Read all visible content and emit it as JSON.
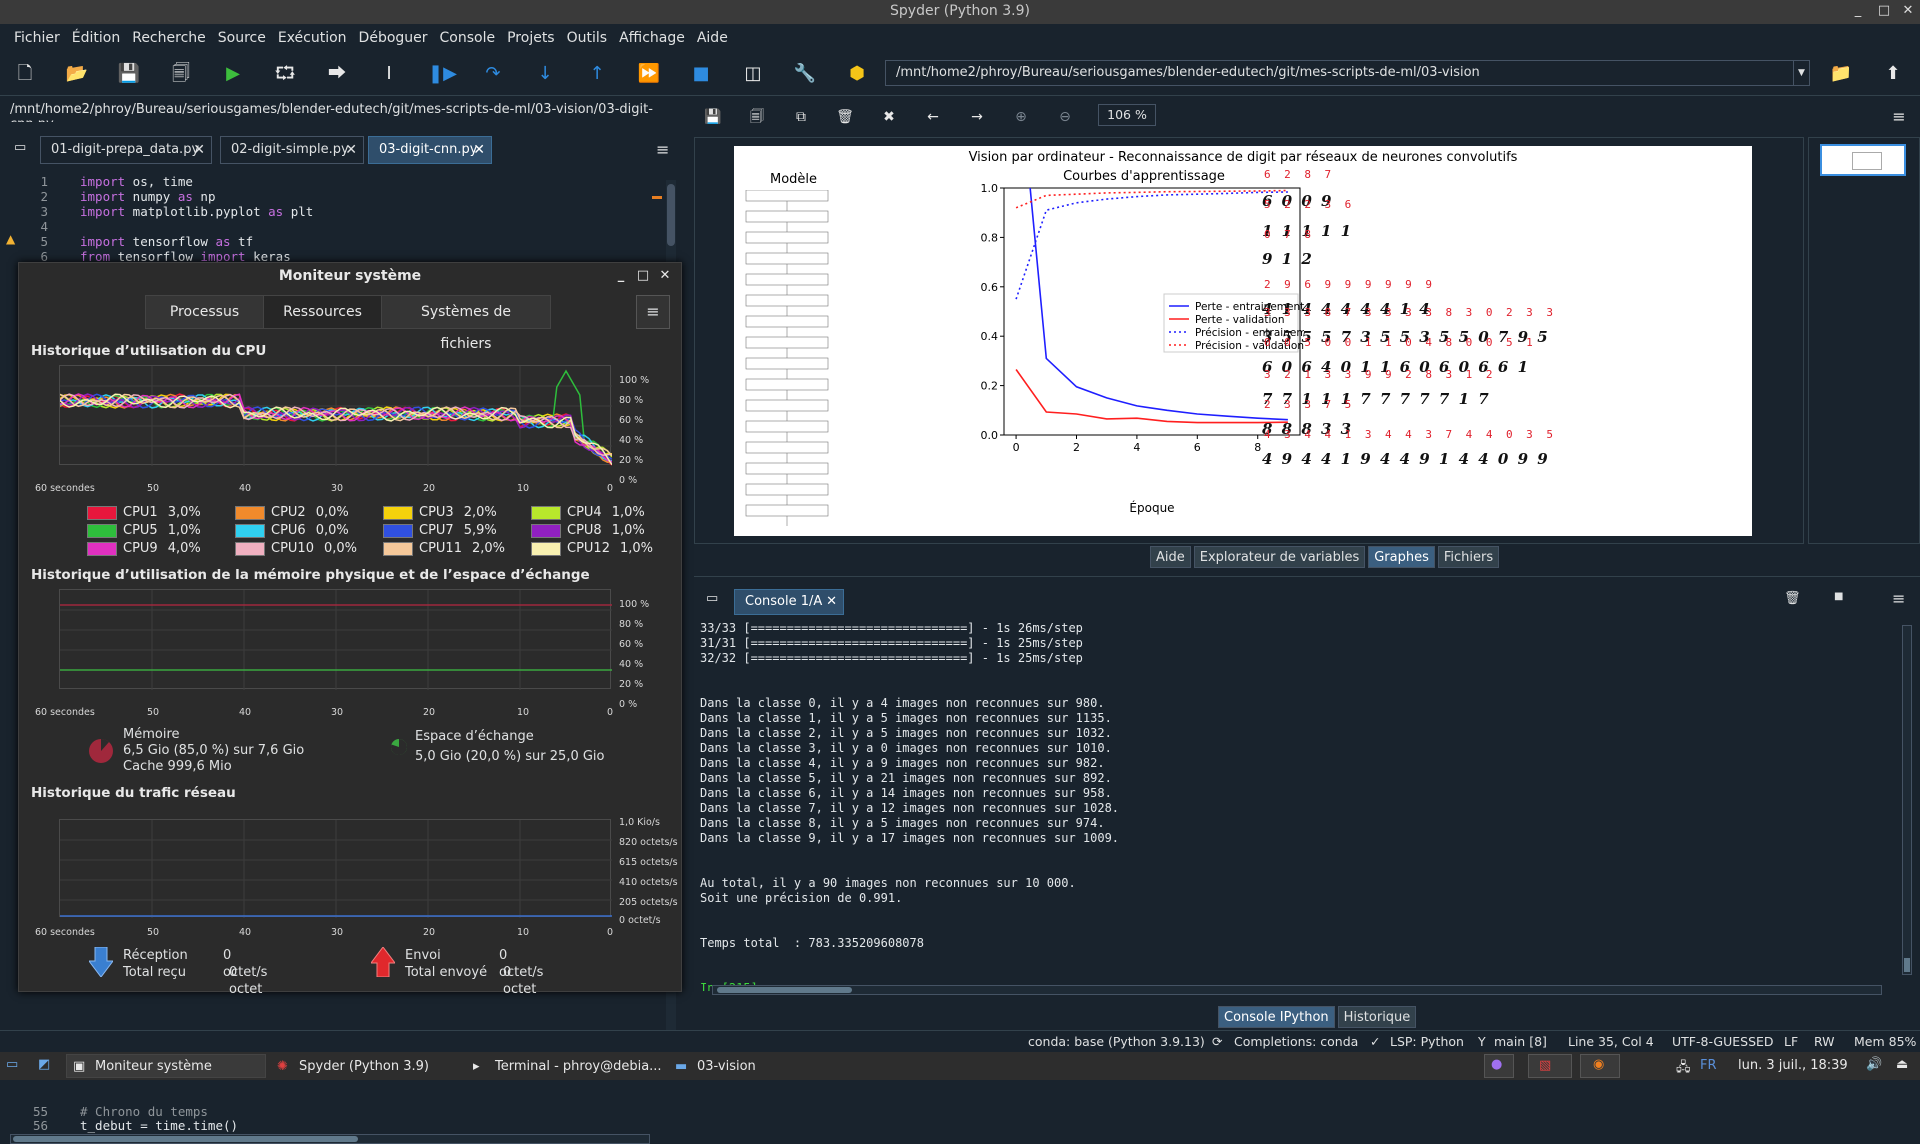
{
  "window": {
    "title": "Spyder (Python 3.9)"
  },
  "menu": [
    "Fichier",
    "Édition",
    "Recherche",
    "Source",
    "Exécution",
    "Déboguer",
    "Console",
    "Projets",
    "Outils",
    "Affichage",
    "Aide"
  ],
  "toolbar": {
    "working_dir": "/mnt/home2/phroy/Bureau/seriousgames/blender-edutech/git/mes-scripts-de-ml/03-vision"
  },
  "editor": {
    "path": "/mnt/home2/phroy/Bureau/seriousgames/blender-edutech/git/mes-scripts-de-ml/03-vision/03-digit-cnn.py",
    "tabs": [
      "01-digit-prepa_data.py",
      "02-digit-simple.py",
      "03-digit-cnn.py"
    ],
    "lines": [
      {
        "n": "1",
        "code": "import os, time"
      },
      {
        "n": "2",
        "code": "import numpy as np"
      },
      {
        "n": "3",
        "code": "import matplotlib.pyplot as plt"
      },
      {
        "n": "4",
        "code": ""
      },
      {
        "n": "5",
        "code": "import tensorflow as tf"
      },
      {
        "n": "6",
        "code": "from tensorflow import keras"
      }
    ],
    "bottom_lines": [
      {
        "n": "55",
        "code": "# Chrono du temps"
      },
      {
        "n": "56",
        "code": "t_debut = time.time()"
      }
    ]
  },
  "sysmon": {
    "title": "Moniteur système",
    "tabs": [
      "Processus",
      "Ressources",
      "Systèmes de fichiers"
    ],
    "cpu_heading": "Historique d’utilisation du CPU",
    "mem_heading": "Historique d’utilisation de la mémoire physique et de l’espace d’échange",
    "net_heading": "Historique du trafic réseau",
    "pct_ticks": [
      "100 %",
      "80 %",
      "60 %",
      "40 %",
      "20 %",
      "0 %"
    ],
    "time_ticks": [
      "60 secondes",
      "50",
      "40",
      "30",
      "20",
      "10",
      "0"
    ],
    "net_ticks": [
      "1,0 Kio/s",
      "820 octets/s",
      "615 octets/s",
      "410 octets/s",
      "205 octets/s",
      "0 octet/s"
    ],
    "cpus": [
      {
        "name": "CPU1",
        "value": "3,0%",
        "color": "#e8173c"
      },
      {
        "name": "CPU2",
        "value": "0,0%",
        "color": "#f08a2c"
      },
      {
        "name": "CPU3",
        "value": "2,0%",
        "color": "#f5d20c"
      },
      {
        "name": "CPU4",
        "value": "1,0%",
        "color": "#b8e82c"
      },
      {
        "name": "CPU5",
        "value": "1,0%",
        "color": "#2ebd3c"
      },
      {
        "name": "CPU6",
        "value": "0,0%",
        "color": "#30d0f0"
      },
      {
        "name": "CPU7",
        "value": "5,9%",
        "color": "#3050e0"
      },
      {
        "name": "CPU8",
        "value": "1,0%",
        "color": "#9020c0"
      },
      {
        "name": "CPU9",
        "value": "4,0%",
        "color": "#e030c0"
      },
      {
        "name": "CPU10",
        "value": "0,0%",
        "color": "#f0b0c0"
      },
      {
        "name": "CPU11",
        "value": "2,0%",
        "color": "#f5c89a"
      },
      {
        "name": "CPU12",
        "value": "1,0%",
        "color": "#f8f0b0"
      }
    ],
    "memory": {
      "label": "Mémoire",
      "line1": "6,5  Gio (85,0  %) sur 7,6  Gio",
      "line2": "Cache 999,6  Mio"
    },
    "swap": {
      "label": "Espace d’échange",
      "line1": "5,0  Gio (20,0  %) sur 25,0  Gio"
    },
    "net": {
      "recv_label": "Réception",
      "recv_value": "0 octet/s",
      "recv_total_label": "Total reçu",
      "recv_total": "0 octet",
      "send_label": "Envoi",
      "send_value": "0 octet/s",
      "send_total_label": "Total envoyé",
      "send_total": "0 octet"
    }
  },
  "plot": {
    "zoom": "106 %",
    "suptitle": "Vision par ordinateur - Reconnaissance de digit par réseaux de neurones convolutifs",
    "model_title": "Modèle",
    "legend": [
      "Perte - entrainement",
      "Perte - validation",
      "Précision - entrainement",
      "Précision - validation"
    ],
    "digit_rows": [
      {
        "labels": "6  2  8  7",
        "digits": "6 0 0 9"
      },
      {
        "labels": "5  2  2  3  6",
        "digits": "1 1 1 1 1"
      },
      {
        "labels": "0  7  8",
        "digits": "9 1 2"
      },
      {
        "labels": "2  9  6  9  9  9  9  9  9",
        "digits": "4 1 4 4 4 4 4 1 4"
      },
      {
        "labels": "3  3  3  8  7  3  3  3  3  8  3  0  2  3  3",
        "digits": "3 5 5 5 7 3 5 5 3 5 5 0 7 9 5"
      },
      {
        "labels": "0  0  5  0  0  1  1  0  4  8  0  0  5  1",
        "digits": "6 0 6 4 0 1 1 6 0 6 0 6 6 1"
      },
      {
        "labels": "3  2  1  3  3  9  9  2  8  3  1  2",
        "digits": "7 7 1 1 1 7 7 7 7 7 1 7"
      },
      {
        "labels": "2  3  3  7  5",
        "digits": "8 8 8 3 3"
      },
      {
        "labels": "4  3  4  4  1  3  4  4  3  7  4  4  0  3  5",
        "digits": "4 9 4 4 1 9 4 4 9 1 4 4 0 9 9"
      }
    ]
  },
  "chart_data": {
    "type": "line",
    "title": "Courbes d'apprentissage",
    "xlabel": "Époque",
    "ylabel": "",
    "xlim": [
      -0.4,
      9.4
    ],
    "ylim": [
      0.0,
      1.0
    ],
    "xticks": [
      0,
      2,
      4,
      6,
      8
    ],
    "yticks": [
      0.0,
      0.2,
      0.4,
      0.6,
      0.8,
      1.0
    ],
    "x": [
      0,
      1,
      2,
      3,
      4,
      5,
      6,
      7,
      8,
      9
    ],
    "series": [
      {
        "name": "Perte - entrainement",
        "color": "#1f1fff",
        "style": "solid",
        "values": [
          1.6,
          0.31,
          0.195,
          0.15,
          0.118,
          0.1,
          0.085,
          0.076,
          0.068,
          0.062
        ]
      },
      {
        "name": "Perte - validation",
        "color": "#ff1f1f",
        "style": "solid",
        "values": [
          0.265,
          0.093,
          0.085,
          0.065,
          0.068,
          0.055,
          0.05,
          0.05,
          0.05,
          0.052
        ]
      },
      {
        "name": "Précision - entrainement",
        "color": "#1f1fff",
        "style": "dotted",
        "values": [
          0.55,
          0.91,
          0.94,
          0.955,
          0.965,
          0.972,
          0.975,
          0.978,
          0.982,
          0.984
        ]
      },
      {
        "name": "Précision - validation",
        "color": "#ff1f1f",
        "style": "dotted",
        "values": [
          0.92,
          0.97,
          0.975,
          0.98,
          0.982,
          0.985,
          0.986,
          0.987,
          0.988,
          0.99
        ]
      }
    ],
    "legend_position": "center-right"
  },
  "pane_tabs": [
    "Aide",
    "Explorateur de variables",
    "Graphes",
    "Fichiers"
  ],
  "console": {
    "tab": "Console 1/A",
    "lines": [
      "33/33 [==============================] - 1s 26ms/step",
      "31/31 [==============================] - 1s 25ms/step",
      "32/32 [==============================] - 1s 25ms/step",
      "",
      "",
      "Dans la classe 0, il y a 4 images non reconnues sur 980.",
      "Dans la classe 1, il y a 5 images non reconnues sur 1135.",
      "Dans la classe 2, il y a 5 images non reconnues sur 1032.",
      "Dans la classe 3, il y a 0 images non reconnues sur 1010.",
      "Dans la classe 4, il y a 9 images non reconnues sur 982.",
      "Dans la classe 5, il y a 21 images non reconnues sur 892.",
      "Dans la classe 6, il y a 14 images non reconnues sur 958.",
      "Dans la classe 7, il y a 12 images non reconnues sur 1028.",
      "Dans la classe 8, il y a 5 images non reconnues sur 974.",
      "Dans la classe 9, il y a 17 images non reconnues sur 1009.",
      "",
      "",
      "Au total, il y a 90 images non reconnues sur 10 000.",
      "Soit une précision de 0.991.",
      "",
      "",
      "Temps total  : 783.335209608078",
      "",
      "",
      "In [215]:"
    ],
    "bottom_tabs": [
      "Console IPython",
      "Historique"
    ]
  },
  "statusbar": {
    "env": "conda: base (Python 3.9.13)",
    "completions": "Completions: conda",
    "lsp": "LSP: Python",
    "git": "main [8]",
    "cursor": "Line 35, Col 4",
    "encoding": "UTF-8-GUESSED",
    "eol": "LF",
    "rw": "RW",
    "mem": "Mem 85%"
  },
  "taskbar": {
    "tasks": [
      "Moniteur système",
      "Spyder (Python 3.9)",
      "Terminal - phroy@debia...",
      "03-vision"
    ],
    "lang": "FR",
    "clock": "lun.  3 juil., 18:39"
  }
}
